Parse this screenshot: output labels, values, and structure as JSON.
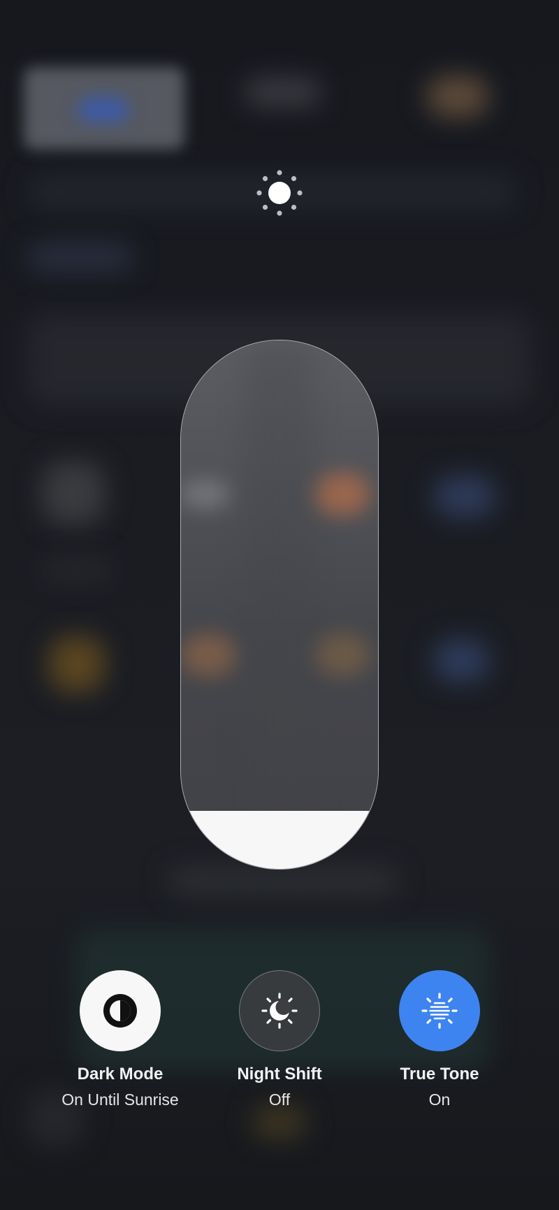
{
  "brightness": {
    "icon": "sun-icon",
    "level": 0.11
  },
  "controls": [
    {
      "id": "dark-mode",
      "label": "Dark Mode",
      "status": "On Until Sunrise",
      "icon": "appearance-half-circle-icon",
      "active": true
    },
    {
      "id": "night-shift",
      "label": "Night Shift",
      "status": "Off",
      "icon": "night-shift-sun-moon-icon",
      "active": false
    },
    {
      "id": "true-tone",
      "label": "True Tone",
      "status": "On",
      "icon": "true-tone-sun-icon",
      "active": true
    }
  ],
  "colors": {
    "accent": "#3e84f0",
    "fill": "#f7f7f8",
    "background": "#15171c"
  }
}
